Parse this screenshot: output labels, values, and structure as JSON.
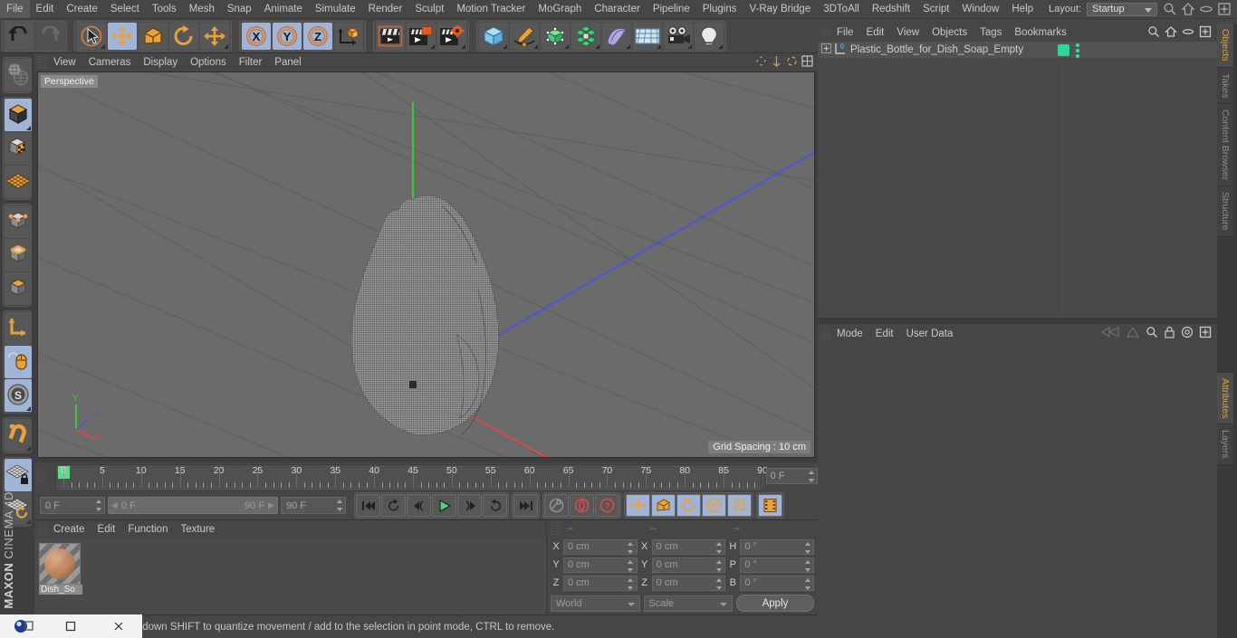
{
  "app": {
    "brand_line1": "MAXON",
    "brand_line2": "CINEMA 4D"
  },
  "menubar": {
    "items": [
      "File",
      "Edit",
      "Create",
      "Select",
      "Tools",
      "Mesh",
      "Snap",
      "Animate",
      "Simulate",
      "Render",
      "Sculpt",
      "Motion Tracker",
      "MoGraph",
      "Character",
      "Pipeline",
      "Plugins",
      "V-Ray Bridge",
      "3DToAll",
      "Redshift",
      "Script",
      "Window",
      "Help"
    ],
    "layout_label": "Layout:",
    "layout_value": "Startup",
    "right_icons": [
      "search-icon",
      "home-icon",
      "minimize-icon",
      "maximize-icon"
    ]
  },
  "toolbar": {
    "groups": [
      {
        "name": "undo-redo",
        "buttons": [
          {
            "name": "undo-button",
            "icon": "undo-arrow-icon",
            "selected": false,
            "dim": false,
            "corner": false
          },
          {
            "name": "redo-button",
            "icon": "redo-arrow-icon",
            "selected": false,
            "dim": true,
            "corner": false
          }
        ]
      },
      {
        "name": "transform-tools",
        "buttons": [
          {
            "name": "live-selection-tool",
            "icon": "cursor-circle-icon",
            "selected": false,
            "dim": false,
            "corner": true
          },
          {
            "name": "move-tool",
            "icon": "move-arrows-icon",
            "selected": true,
            "dim": false,
            "corner": false
          },
          {
            "name": "scale-tool",
            "icon": "scale-box-icon",
            "selected": false,
            "dim": false,
            "corner": false
          },
          {
            "name": "rotate-tool",
            "icon": "rotate-circle-icon",
            "selected": false,
            "dim": false,
            "corner": false
          },
          {
            "name": "dynamic-place-tool",
            "icon": "move-arrows-icon",
            "selected": false,
            "dim": false,
            "corner": true
          }
        ]
      },
      {
        "name": "axis-locks",
        "buttons": [
          {
            "name": "lock-x-axis-button",
            "icon": "x-axis-icon",
            "selected": true,
            "dim": false,
            "corner": false
          },
          {
            "name": "lock-y-axis-button",
            "icon": "y-axis-icon",
            "selected": true,
            "dim": false,
            "corner": false
          },
          {
            "name": "lock-z-axis-button",
            "icon": "z-axis-icon",
            "selected": true,
            "dim": false,
            "corner": false
          },
          {
            "name": "world-object-coordinates-button",
            "icon": "world-axis-cube-icon",
            "selected": false,
            "dim": false,
            "corner": false
          }
        ]
      },
      {
        "name": "render-tools",
        "buttons": [
          {
            "name": "render-view-button",
            "icon": "clapper-view-icon",
            "selected": false,
            "dim": false,
            "corner": false
          },
          {
            "name": "render-to-picture-viewer-button",
            "icon": "clapper-picture-icon",
            "selected": false,
            "dim": false,
            "corner": true
          },
          {
            "name": "render-settings-button",
            "icon": "clapper-gear-icon",
            "selected": false,
            "dim": false,
            "corner": true
          }
        ]
      },
      {
        "name": "creation-tools",
        "buttons": [
          {
            "name": "add-cube-button",
            "icon": "cube-primitive-icon",
            "selected": false,
            "dim": false,
            "corner": true
          },
          {
            "name": "add-spline-button",
            "icon": "pen-spline-icon",
            "selected": false,
            "dim": false,
            "corner": true
          },
          {
            "name": "add-generator-button",
            "icon": "green-cube-generator-icon",
            "selected": false,
            "dim": false,
            "corner": true
          },
          {
            "name": "add-deformer-button",
            "icon": "green-cluster-deformer-icon",
            "selected": false,
            "dim": false,
            "corner": true
          },
          {
            "name": "add-environment-button",
            "icon": "purple-sky-icon",
            "selected": false,
            "dim": false,
            "corner": true
          },
          {
            "name": "add-floor-button",
            "icon": "grid-floor-icon",
            "selected": false,
            "dim": false,
            "corner": true
          },
          {
            "name": "add-camera-button",
            "icon": "camera-icon",
            "selected": false,
            "dim": false,
            "corner": true
          },
          {
            "name": "add-light-button",
            "icon": "light-bulb-icon",
            "selected": false,
            "dim": false,
            "corner": true
          }
        ]
      }
    ]
  },
  "leftbar": {
    "groups": [
      {
        "name": "render-region-group",
        "buttons": [
          {
            "name": "make-editable-globe-button",
            "icon": "globe-mesh-icon",
            "selected": false,
            "corner": false
          }
        ]
      },
      {
        "name": "mode-group-1",
        "buttons": [
          {
            "name": "model-mode-button",
            "icon": "model-cube-icon",
            "selected": true,
            "corner": true
          },
          {
            "name": "texture-mode-button",
            "icon": "texture-cube-icon",
            "selected": false,
            "corner": false
          },
          {
            "name": "workplane-mode-button",
            "icon": "workplane-grid-icon",
            "selected": false,
            "corner": false
          }
        ]
      },
      {
        "name": "mode-group-2",
        "buttons": [
          {
            "name": "points-mode-button",
            "icon": "points-cube-icon",
            "selected": false,
            "corner": false
          },
          {
            "name": "edges-mode-button",
            "icon": "edges-cube-icon",
            "selected": false,
            "corner": false
          },
          {
            "name": "polygons-mode-button",
            "icon": "polygons-cube-icon",
            "selected": false,
            "corner": false
          }
        ]
      },
      {
        "name": "axis-group",
        "buttons": [
          {
            "name": "enable-axis-modification-button",
            "icon": "axis-arrow-icon",
            "selected": false,
            "corner": false
          },
          {
            "name": "viewport-solo-single-button",
            "icon": "mouse-cursor-icon",
            "selected": true,
            "corner": false
          },
          {
            "name": "viewport-solo-selection-button",
            "icon": "s-sphere-icon",
            "selected": true,
            "corner": true
          }
        ]
      },
      {
        "name": "snap-group",
        "buttons": [
          {
            "name": "enable-snap-button",
            "icon": "magnet-icon",
            "selected": false,
            "corner": true
          }
        ]
      },
      {
        "name": "workplane-group",
        "buttons": [
          {
            "name": "lock-workplane-button",
            "icon": "workplane-lock-icon",
            "selected": true,
            "corner": false
          },
          {
            "name": "planar-workplane-button",
            "icon": "workplane-rotate-icon",
            "selected": false,
            "corner": true
          }
        ]
      }
    ]
  },
  "viewport": {
    "menu": [
      "View",
      "Cameras",
      "Display",
      "Options",
      "Filter",
      "Panel"
    ],
    "label": "Perspective",
    "grid_spacing": "Grid Spacing : 10 cm",
    "axis_labels": {
      "x": "X",
      "y": "Y",
      "z": "Z"
    },
    "axis_colors": {
      "x": "#e04b4b",
      "y": "#48d048",
      "z": "#4a5ce0"
    },
    "background": "#6b6b6b",
    "object_style": "point-cloud-bottle"
  },
  "timeline": {
    "ticks": [
      0,
      5,
      10,
      15,
      20,
      25,
      30,
      35,
      40,
      45,
      50,
      55,
      60,
      65,
      70,
      75,
      80,
      85,
      90
    ],
    "current_frame_field": "0 F",
    "playhead_frame": 0,
    "min": 0,
    "max": 90
  },
  "playbar": {
    "current_frame": "0 F",
    "range_start": "0 F",
    "range_end": "90 F",
    "end_frame": "90 F",
    "buttons": [
      {
        "name": "go-to-start-button",
        "icon": "skip-start-icon",
        "selected": false
      },
      {
        "name": "play-backwards-frame-button",
        "icon": "rewind-loop-icon",
        "selected": false
      },
      {
        "name": "previous-frame-button",
        "icon": "step-back-icon",
        "selected": false
      },
      {
        "name": "play-button",
        "icon": "play-triangle-icon",
        "selected": false
      },
      {
        "name": "next-frame-button",
        "icon": "step-forward-icon",
        "selected": false
      },
      {
        "name": "play-forwards-loop-button",
        "icon": "forward-loop-icon",
        "selected": false
      },
      {
        "name": "go-to-end-button",
        "icon": "skip-end-icon",
        "selected": false
      }
    ],
    "key_buttons": [
      {
        "name": "autokeying-button",
        "icon": "key-icon",
        "selected": false
      },
      {
        "name": "record-active-objects-button",
        "icon": "record-circle-icon",
        "selected": false
      },
      {
        "name": "keyframe-selection-button",
        "icon": "question-circle-icon",
        "selected": false
      }
    ],
    "record_toggles": [
      {
        "name": "record-position-button",
        "icon": "move-arrows-icon",
        "selected": true
      },
      {
        "name": "record-scale-button",
        "icon": "scale-box-icon",
        "selected": true
      },
      {
        "name": "record-rotation-button",
        "icon": "rotate-circle-icon",
        "selected": true
      },
      {
        "name": "record-parameter-button",
        "icon": "p-circle-icon",
        "selected": true
      },
      {
        "name": "record-pla-button",
        "icon": "point-grid-icon",
        "selected": true
      }
    ],
    "timeline_toggle": {
      "name": "timeline-toggle-button",
      "icon": "film-strip-icon",
      "selected": true
    }
  },
  "material_manager": {
    "menu": [
      "Create",
      "Edit",
      "Function",
      "Texture"
    ],
    "materials": [
      {
        "name": "Dish_So"
      }
    ]
  },
  "coordinates": {
    "headers": [
      "--",
      "--",
      "--"
    ],
    "rows": [
      {
        "pos_label": "X",
        "pos_value": "0 cm",
        "size_label": "X",
        "size_value": "0 cm",
        "rot_label": "H",
        "rot_value": "0 °"
      },
      {
        "pos_label": "Y",
        "pos_value": "0 cm",
        "size_label": "Y",
        "size_value": "0 cm",
        "rot_label": "P",
        "rot_value": "0 °"
      },
      {
        "pos_label": "Z",
        "pos_value": "0 cm",
        "size_label": "Z",
        "size_value": "0 cm",
        "rot_label": "B",
        "rot_value": "0 °"
      }
    ],
    "system": "World",
    "mode": "Scale",
    "apply_label": "Apply"
  },
  "statusbar": {
    "text": "move elements. Hold down SHIFT to quantize movement / add to the selection in point mode, CTRL to remove."
  },
  "objects_panel": {
    "menu": [
      "File",
      "Edit",
      "View",
      "Objects",
      "Tags",
      "Bookmarks"
    ],
    "right_icons": [
      "search-icon",
      "home-icon",
      "ellipse-icon",
      "add-panel-icon"
    ],
    "rows": [
      {
        "name": "Plastic_Bottle_for_Dish_Soap_Empty",
        "tag_color": "#2fd69a",
        "layer_dots": 3
      }
    ]
  },
  "attributes_panel": {
    "menu": [
      "Mode",
      "Edit",
      "User Data"
    ],
    "right_icons": [
      "history-back-icon",
      "history-forward-icon",
      "search-icon",
      "lock-icon",
      "target-icon",
      "add-panel-icon"
    ]
  },
  "rail": {
    "top_tabs": [
      {
        "label": "Objects",
        "active": true
      },
      {
        "label": "Takes",
        "active": false
      },
      {
        "label": "Content Browser",
        "active": false
      },
      {
        "label": "Structure",
        "active": false
      }
    ],
    "bottom_tabs": [
      {
        "label": "Attributes",
        "active": true
      },
      {
        "label": "Layers",
        "active": false
      }
    ]
  },
  "taskbar": {
    "items": [
      "app-icon",
      "restore-window-button",
      "maximize-window-button",
      "close-window-button"
    ]
  }
}
